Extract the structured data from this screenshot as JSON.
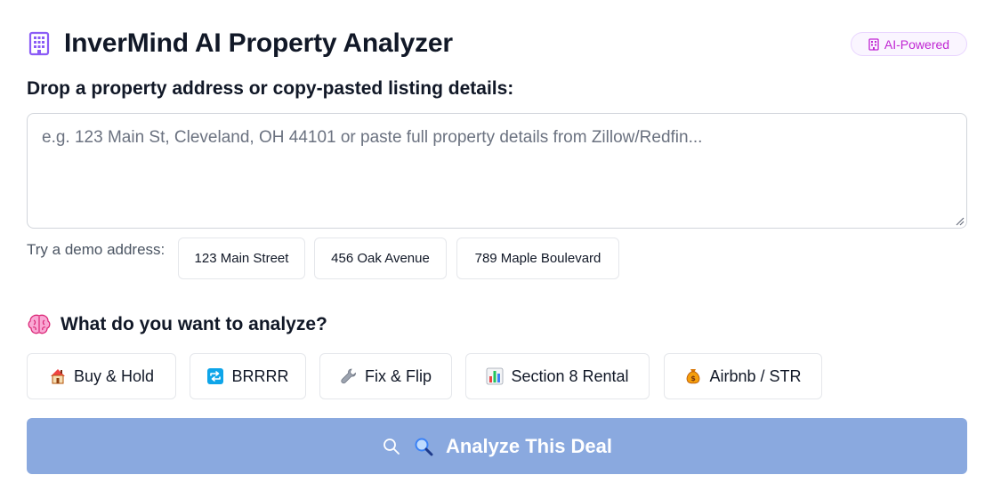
{
  "header": {
    "title": "InverMind AI Property Analyzer",
    "badge": "AI-Powered"
  },
  "input_section": {
    "label": "Drop a property address or copy-pasted listing details:",
    "placeholder": "e.g. 123 Main St, Cleveland, OH 44101 or paste full property details from Zillow/Redfin...",
    "value": ""
  },
  "demo": {
    "label": "Try a demo address:",
    "addresses": [
      "123 Main Street",
      "456 Oak Avenue",
      "789 Maple Boulevard"
    ]
  },
  "analysis": {
    "title": "What do you want to analyze?",
    "title_icon": "brain-icon",
    "strategies": [
      {
        "label": "Buy & Hold",
        "icon": "house-icon"
      },
      {
        "label": "BRRRR",
        "icon": "repeat-icon"
      },
      {
        "label": "Fix & Flip",
        "icon": "wrench-icon"
      },
      {
        "label": "Section 8 Rental",
        "icon": "bar-chart-icon"
      },
      {
        "label": "Airbnb / STR",
        "icon": "money-bag-icon"
      }
    ]
  },
  "cta": {
    "label": "Analyze This Deal",
    "icons": [
      "search-icon",
      "magnifier-emoji-icon"
    ]
  },
  "colors": {
    "primary_button": "#8aa9df",
    "badge_text": "#c026d3",
    "badge_bg": "#faf5ff",
    "icon_purple": "#a78bfa",
    "border": "#e5e7eb"
  }
}
